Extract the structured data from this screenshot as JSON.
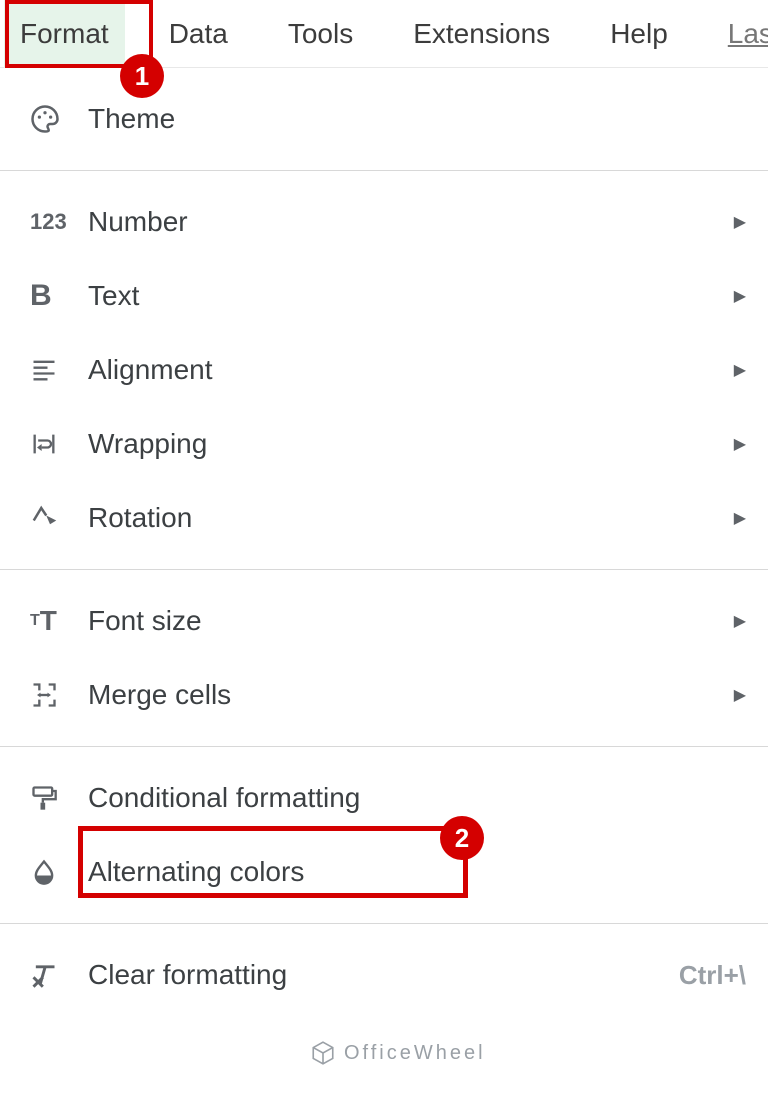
{
  "menubar": {
    "format": "Format",
    "data": "Data",
    "tools": "Tools",
    "extensions": "Extensions",
    "help": "Help",
    "last": "Last"
  },
  "menu": {
    "theme": "Theme",
    "number": "Number",
    "text": "Text",
    "alignment": "Alignment",
    "wrapping": "Wrapping",
    "rotation": "Rotation",
    "font_size": "Font size",
    "merge_cells": "Merge cells",
    "conditional_formatting": "Conditional formatting",
    "alternating_colors": "Alternating colors",
    "clear_formatting": "Clear formatting",
    "clear_formatting_shortcut": "Ctrl+\\"
  },
  "badges": {
    "one": "1",
    "two": "2"
  },
  "watermark": "OfficeWheel"
}
